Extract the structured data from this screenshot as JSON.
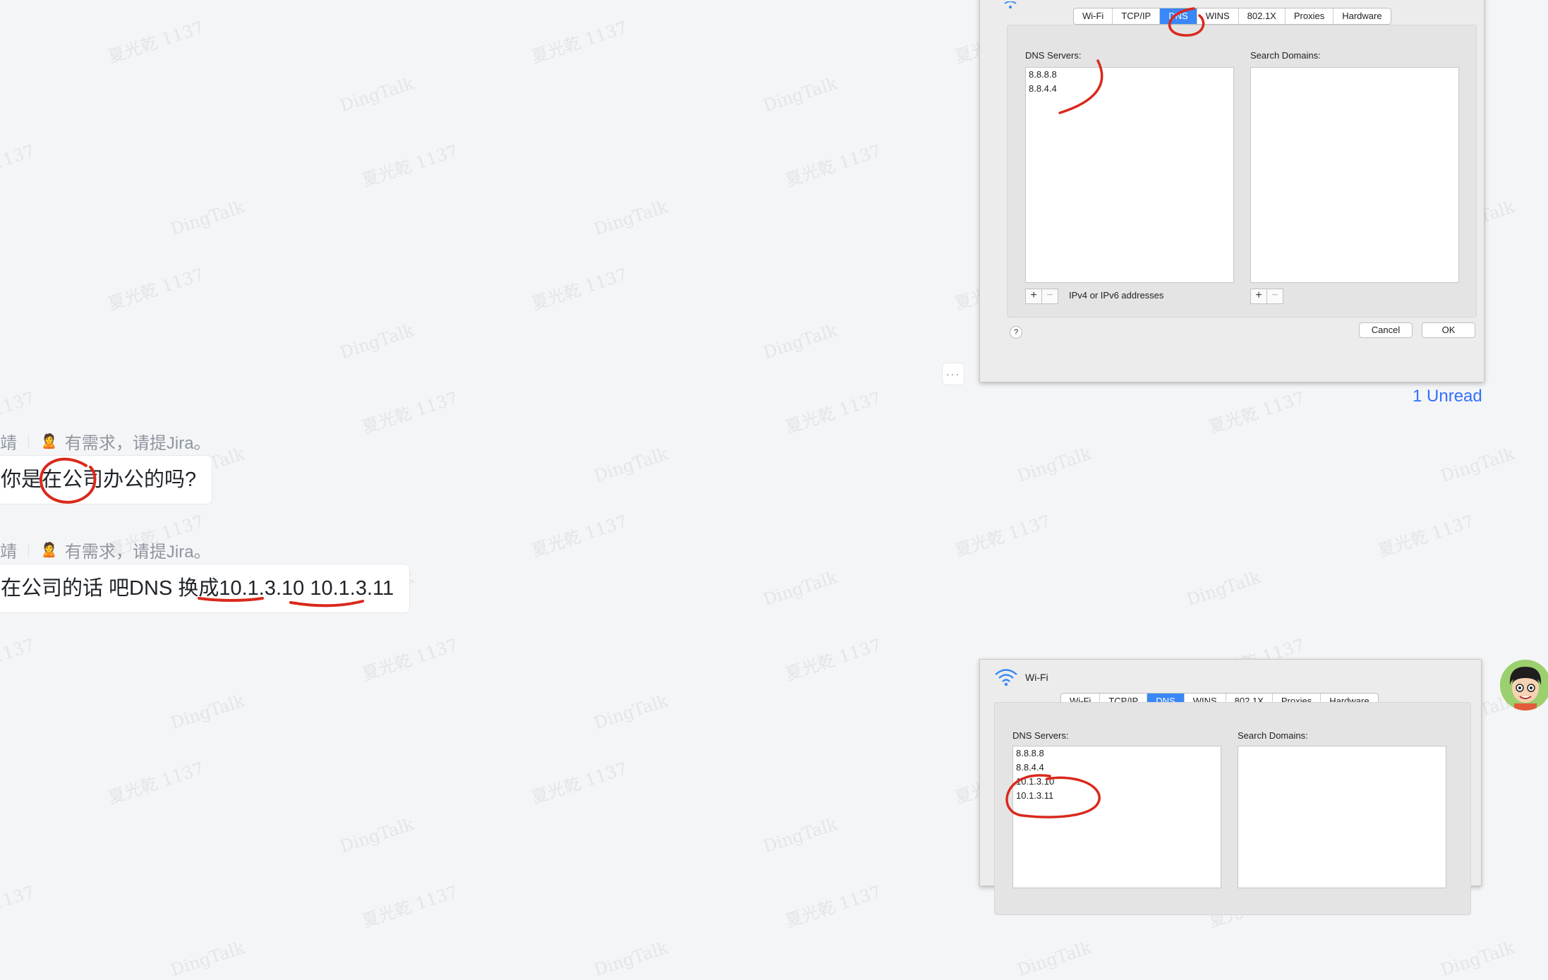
{
  "watermark": {
    "name": "夏光乾 1137",
    "brand": "DingTalk"
  },
  "messages": [
    {
      "sender": {
        "name": "靖",
        "signature_emoji": "🙎",
        "signature": "有需求，请提Jira。"
      },
      "text": "你是在公司办公的吗?"
    },
    {
      "sender": {
        "name": "靖",
        "signature_emoji": "🙎",
        "signature": "有需求，请提Jira。"
      },
      "text_prefix": "在公司的话 吧DNS 换成",
      "ip1": "10.1.3.10",
      "ip2": "10.1.3.11"
    }
  ],
  "more_button": {
    "glyph": "···"
  },
  "unread_label": "1 Unread",
  "dialog_top": {
    "tabs": [
      "Wi-Fi",
      "TCP/IP",
      "DNS",
      "WINS",
      "802.1X",
      "Proxies",
      "Hardware"
    ],
    "active_tab": "DNS",
    "dns_label": "DNS Servers:",
    "search_label": "Search Domains:",
    "dns_servers": [
      "8.8.8.8",
      "8.8.4.4"
    ],
    "hint": "IPv4 or IPv6 addresses",
    "plus": "+",
    "minus": "−",
    "help": "?",
    "cancel": "Cancel",
    "ok": "OK"
  },
  "dialog_bottom": {
    "title": "Wi-Fi",
    "tabs": [
      "Wi-Fi",
      "TCP/IP",
      "DNS",
      "WINS",
      "802.1X",
      "Proxies",
      "Hardware"
    ],
    "active_tab": "DNS",
    "dns_label": "DNS Servers:",
    "search_label": "Search Domains:",
    "dns_servers": [
      "8.8.8.8",
      "8.8.4.4",
      "10.1.3.10",
      "10.1.3.11"
    ]
  },
  "colors": {
    "background": "#f4f5f7",
    "annotation": "#d9291c",
    "link": "#3370ff",
    "mac_accent": "#3a87f7"
  },
  "avatar": {
    "icon": "cartoon-avatar-icon"
  }
}
